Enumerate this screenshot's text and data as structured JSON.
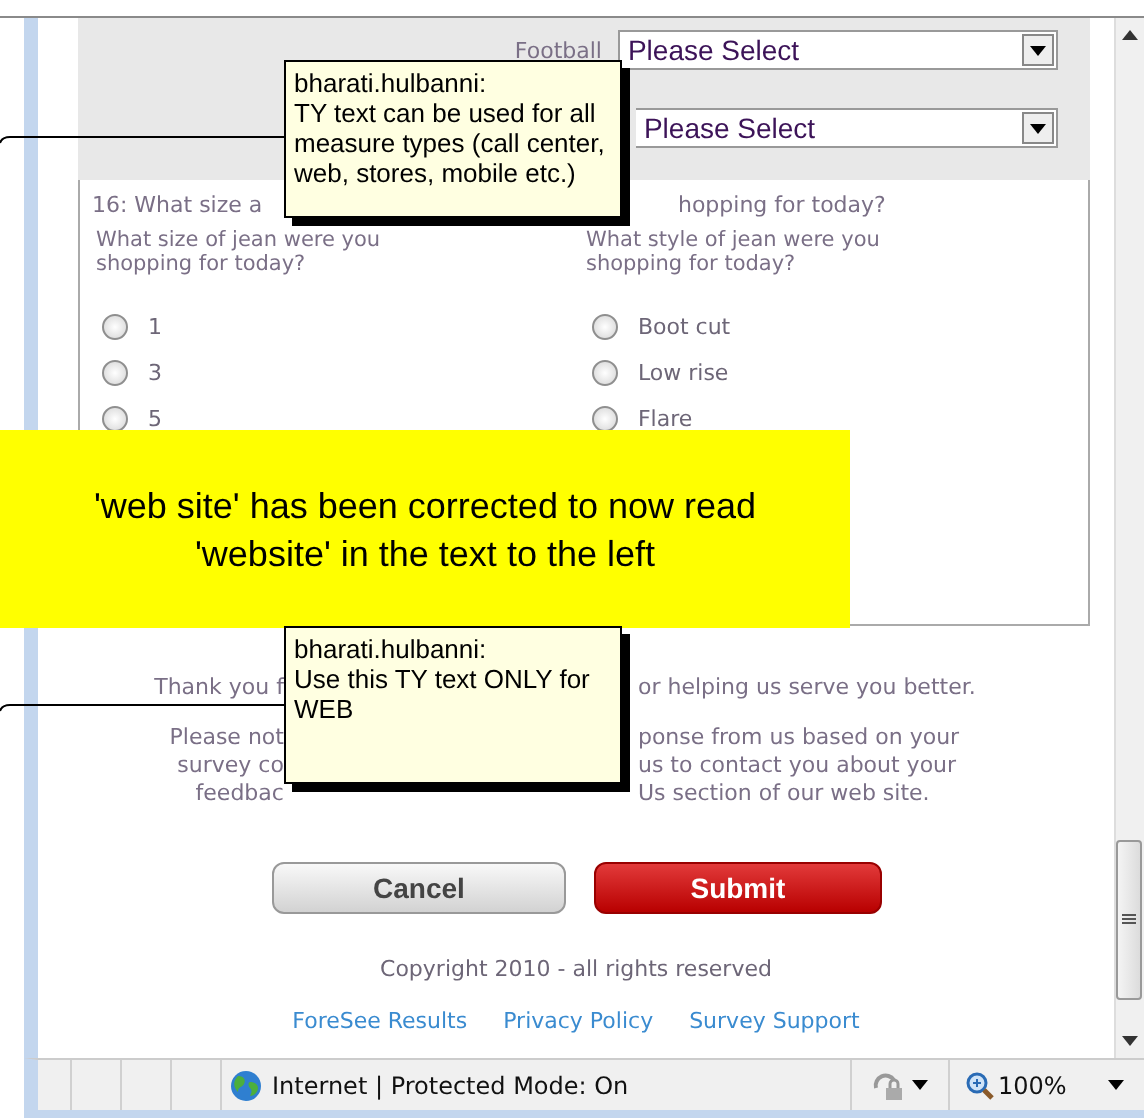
{
  "form": {
    "rows": [
      {
        "label": "Football",
        "select": "Please Select"
      },
      {
        "select": "Please Select"
      }
    ]
  },
  "question": {
    "title_left": "16: What size a",
    "title_right": "hopping for today?",
    "columns": [
      {
        "prompt": "What size of jean were you shopping for today?",
        "options": [
          {
            "label": "1",
            "selected": false
          },
          {
            "label": "3",
            "selected": false
          },
          {
            "label": "5",
            "selected": false
          }
        ]
      },
      {
        "prompt": "What style of jean were you shopping for today?",
        "options": [
          {
            "label": "Boot cut",
            "selected": false
          },
          {
            "label": "Low rise",
            "selected": false
          },
          {
            "label": "Flare",
            "selected": false
          }
        ]
      }
    ]
  },
  "thank_you": {
    "before": "Thank you f",
    "after": "or helping us serve you better."
  },
  "notice_lines": [
    {
      "before": "Please not",
      "after": "ponse from us based on your"
    },
    {
      "before": "survey co",
      "after": "us to contact you about your"
    },
    {
      "before": "feedbac",
      "after": "Us section of our web site."
    }
  ],
  "buttons": [
    {
      "label": "Cancel",
      "kind": "secondary"
    },
    {
      "label": "Submit",
      "kind": "primary"
    }
  ],
  "copyright": "Copyright 2010 - all rights reserved",
  "footer_links": [
    "ForeSee Results",
    "Privacy Policy",
    "Survey Support"
  ],
  "comments": [
    {
      "author": "bharati.hulbanni:",
      "text": "TY text can be used for all measure types (call center, web, stores, mobile etc.)"
    },
    {
      "author": "bharati.hulbanni:",
      "text": "Use this TY text ONLY for WEB"
    }
  ],
  "callout": {
    "text": "'web site' has been corrected to now read 'website' in the text to the left"
  },
  "status_bar": {
    "zone": "Internet | Protected Mode: On",
    "zoom": "100%"
  }
}
